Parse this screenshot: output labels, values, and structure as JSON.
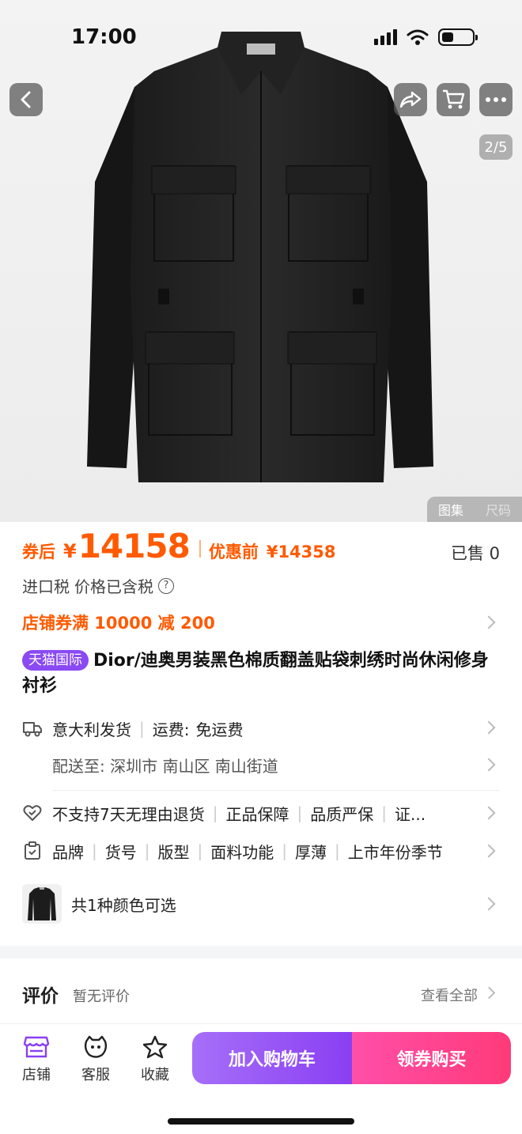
{
  "status_bar": {
    "time": "17:00"
  },
  "hero": {
    "page_indicator": "2/5",
    "gallery_tabs": [
      "图集",
      "尺码"
    ]
  },
  "price": {
    "after_label": "券后",
    "symbol": "¥",
    "value": "14158",
    "before_label": "优惠前",
    "before_value": "¥14358",
    "sold": "已售 0"
  },
  "tax": {
    "label": "进口税",
    "value": "价格已含税"
  },
  "coupon": {
    "text": "店铺券满 10000 减 200"
  },
  "product": {
    "badge": "天猫国际",
    "title": "Dior/迪奥男装黑色棉质翻盖贴袋刺绣时尚休闲修身衬衫"
  },
  "shipping": {
    "origin": "意大利发货",
    "fee_label": "运费:",
    "fee_value": "免运费",
    "delivery": "配送至: 深圳市 南山区 南山街道"
  },
  "guarantees": [
    "不支持7天无理由退货",
    "正品保障",
    "品质严保",
    "证..."
  ],
  "params": [
    "品牌",
    "货号",
    "版型",
    "面料功能",
    "厚薄",
    "上市年份季节"
  ],
  "colors": {
    "text": "共1种颜色可选"
  },
  "reviews": {
    "title": "评价",
    "empty": "暂无评价",
    "view_all": "查看全部"
  },
  "bottom_bar": {
    "tabs": [
      "店铺",
      "客服",
      "收藏"
    ],
    "add_cart": "加入购物车",
    "buy": "领券购买"
  },
  "colors_theme": {
    "accent_orange": "#ff5a00",
    "purple": "#8a3ff2",
    "pink": "#ff3a7a"
  }
}
